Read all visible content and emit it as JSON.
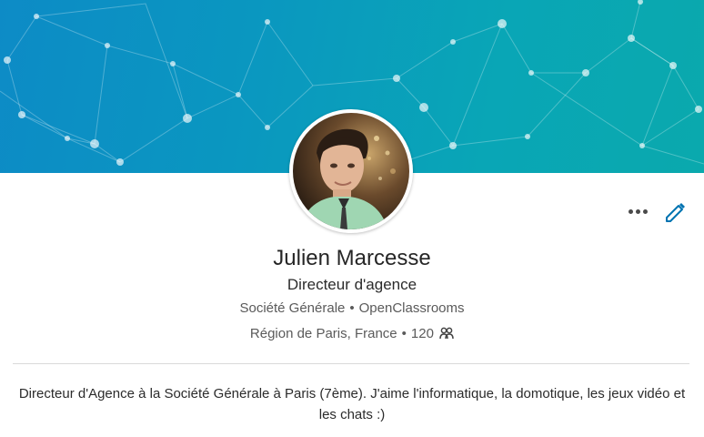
{
  "profile": {
    "name": "Julien Marcesse",
    "headline": "Directeur d'agence",
    "companies": [
      "Société Générale",
      "OpenClassrooms"
    ],
    "separator": "•",
    "location": "Région de Paris, France",
    "connections": "120",
    "summary": "Directeur d'Agence à la Société Générale à Paris (7ème). J'aime l'informatique, la domotique, les jeux vidéo et les chats :)"
  },
  "colors": {
    "banner_start": "#0d8bc6",
    "banner_end": "#0aa9ad",
    "accent": "#0073b1",
    "text": "#262626",
    "muted": "#5a5a5a"
  },
  "icons": {
    "more": "more-icon",
    "edit": "pencil-icon",
    "connections": "people-icon"
  }
}
